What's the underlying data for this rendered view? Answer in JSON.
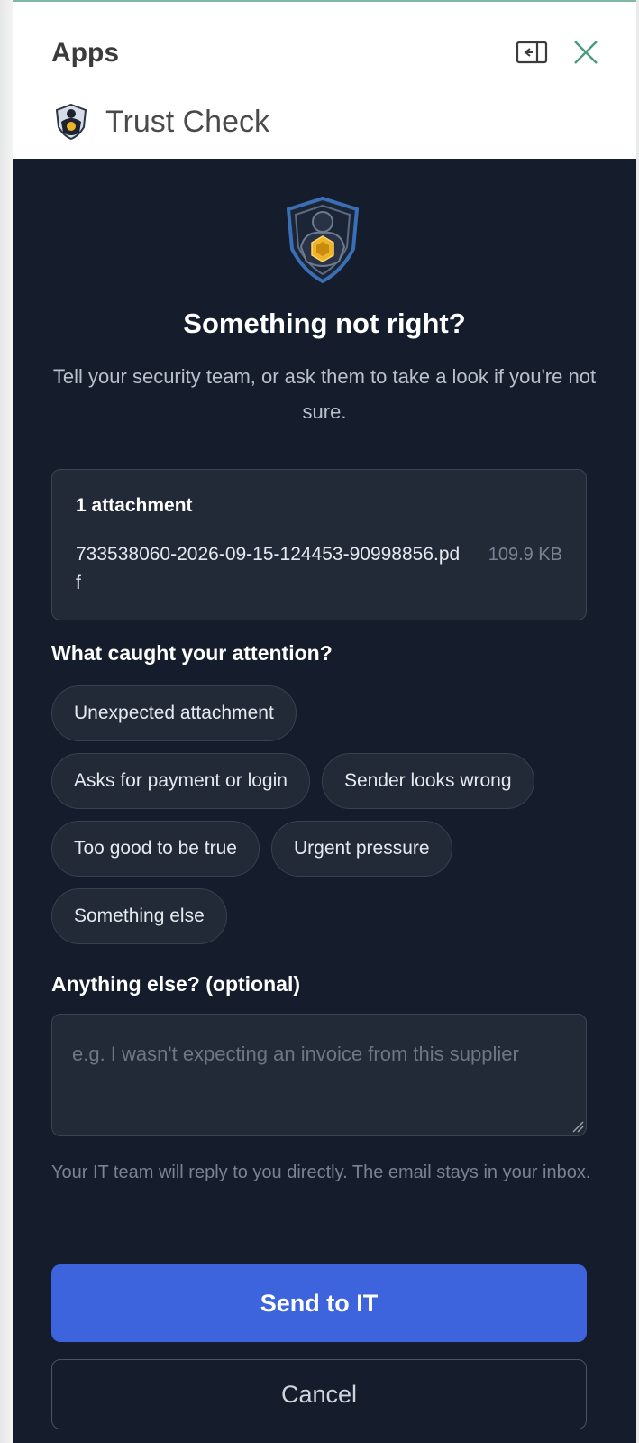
{
  "header": {
    "title": "Apps",
    "app_name": "Trust Check",
    "pin_icon": "pin-pane-icon",
    "close_icon": "close-icon"
  },
  "main": {
    "headline": "Something not right?",
    "subtext": "Tell your security team, or ask them to take a look if you're not sure.",
    "attachment": {
      "count_label": "1 attachment",
      "filename": "733538060-2026-09-15-124453-90998856.pdf",
      "size": "109.9 KB"
    },
    "reasons_label": "What caught your attention?",
    "reasons": [
      "Unexpected attachment",
      "Asks for payment or login",
      "Sender looks wrong",
      "Too good to be true",
      "Urgent pressure",
      "Something else"
    ],
    "notes_label": "Anything else? (optional)",
    "notes_placeholder": "e.g. I wasn't expecting an invoice from this supplier",
    "notes_value": "",
    "disclaimer": "Your IT team will reply to you directly. The email stays in your inbox.",
    "send_label": "Send to IT",
    "cancel_label": "Cancel"
  },
  "colors": {
    "panel_bg": "#151c2b",
    "card_bg": "#222a37",
    "accent": "#3d63dd",
    "logo_gold": "#f0b429",
    "logo_blue": "#3a6fb5"
  }
}
